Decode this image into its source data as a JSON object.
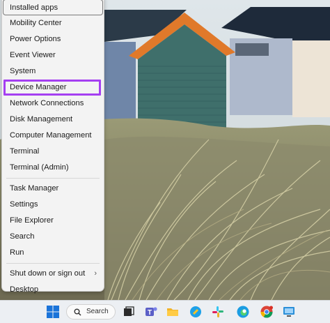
{
  "menu": {
    "items": [
      {
        "label": "Installed apps"
      },
      {
        "label": "Mobility Center"
      },
      {
        "label": "Power Options"
      },
      {
        "label": "Event Viewer"
      },
      {
        "label": "System"
      },
      {
        "label": "Device Manager"
      },
      {
        "label": "Network Connections"
      },
      {
        "label": "Disk Management"
      },
      {
        "label": "Computer Management"
      },
      {
        "label": "Terminal"
      },
      {
        "label": "Terminal (Admin)"
      },
      {
        "label": "Task Manager"
      },
      {
        "label": "Settings"
      },
      {
        "label": "File Explorer"
      },
      {
        "label": "Search"
      },
      {
        "label": "Run"
      },
      {
        "label": "Shut down or sign out"
      },
      {
        "label": "Desktop"
      }
    ],
    "highlighted_item": "Device Manager",
    "highlight_color": "#a53ff1"
  },
  "taskbar": {
    "search_label": "Search",
    "icons": [
      "windows-start-icon",
      "search-icon",
      "task-view-icon",
      "teams-icon",
      "file-explorer-icon",
      "app-icon",
      "slack-icon",
      "edge-icon",
      "chrome-icon",
      "remote-desktop-icon"
    ]
  }
}
